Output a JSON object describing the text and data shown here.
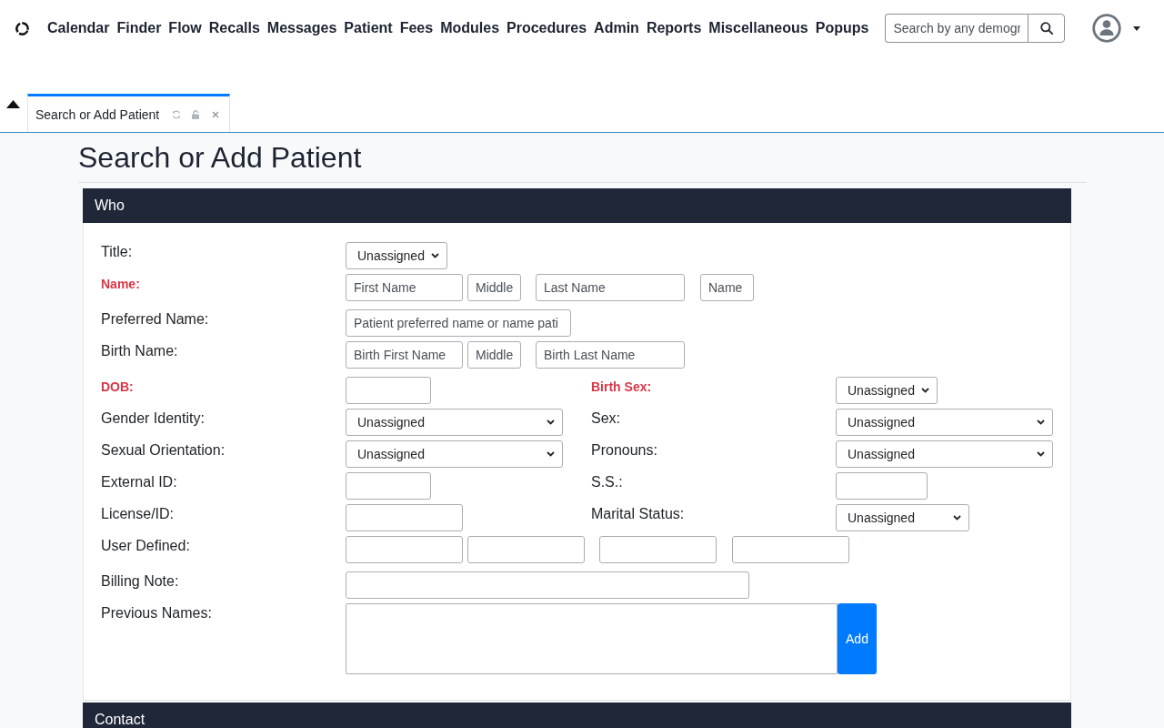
{
  "menu": [
    "Calendar",
    "Finder",
    "Flow",
    "Recalls",
    "Messages",
    "Patient",
    "Fees",
    "Modules",
    "Procedures",
    "Admin",
    "Reports",
    "Miscellaneous",
    "Popups"
  ],
  "search": {
    "placeholder": "Search by any demogr"
  },
  "tabs": [
    {
      "label": "Search or Add Patient",
      "selected": true
    }
  ],
  "page_title": "Search or Add Patient",
  "sections": [
    {
      "title": "Who",
      "rows": [
        {
          "label": "Title:",
          "required": false,
          "controls": [
            {
              "kind": "select",
              "value": "Unassigned"
            }
          ]
        },
        {
          "label": "Name:",
          "required": true,
          "controls": [
            {
              "kind": "input",
              "placeholder": "First Name"
            },
            {
              "kind": "input",
              "placeholder": "Middle"
            },
            {
              "kind": "input",
              "placeholder": "Last Name"
            },
            {
              "kind": "input",
              "placeholder": "Name"
            }
          ]
        },
        {
          "label": "Preferred Name:",
          "required": false,
          "controls": [
            {
              "kind": "input",
              "placeholder": "Patient preferred name or name pati"
            }
          ]
        },
        {
          "label": "Birth Name:",
          "required": false,
          "controls": [
            {
              "kind": "input",
              "placeholder": "Birth First Name"
            },
            {
              "kind": "input",
              "placeholder": "Middle"
            },
            {
              "kind": "input",
              "placeholder": "Birth Last Name"
            }
          ]
        },
        {
          "label": "DOB:",
          "required": true,
          "controls": [
            {
              "kind": "input"
            }
          ],
          "right": {
            "label": "Birth Sex:",
            "required": true,
            "controls": [
              {
                "kind": "select",
                "value": "Unassigned"
              }
            ]
          }
        },
        {
          "label": "Gender Identity:",
          "required": false,
          "controls": [
            {
              "kind": "select",
              "value": "Unassigned"
            }
          ],
          "right": {
            "label": "Sex:",
            "required": false,
            "controls": [
              {
                "kind": "select",
                "value": "Unassigned"
              }
            ]
          }
        },
        {
          "label": "Sexual Orientation:",
          "required": false,
          "controls": [
            {
              "kind": "select",
              "value": "Unassigned"
            }
          ],
          "right": {
            "label": "Pronouns:",
            "required": false,
            "controls": [
              {
                "kind": "select",
                "value": "Unassigned"
              }
            ]
          }
        },
        {
          "label": "External ID:",
          "required": false,
          "controls": [
            {
              "kind": "input"
            }
          ],
          "right": {
            "label": "S.S.:",
            "required": false,
            "controls": [
              {
                "kind": "input"
              }
            ]
          }
        },
        {
          "label": "License/ID:",
          "required": false,
          "controls": [
            {
              "kind": "input"
            }
          ],
          "right": {
            "label": "Marital Status:",
            "required": false,
            "controls": [
              {
                "kind": "select",
                "value": "Unassigned"
              }
            ]
          }
        },
        {
          "label": "User Defined:",
          "required": false,
          "controls": [
            {
              "kind": "input"
            },
            {
              "kind": "input"
            },
            {
              "kind": "input"
            },
            {
              "kind": "input"
            }
          ]
        },
        {
          "label": "Billing Note:",
          "required": false,
          "controls": [
            {
              "kind": "input"
            }
          ]
        },
        {
          "label": "Previous Names:",
          "required": false,
          "controls": [
            {
              "kind": "textarea"
            },
            {
              "kind": "button",
              "label": "Add"
            }
          ]
        }
      ]
    },
    {
      "title": "Contact"
    }
  ]
}
